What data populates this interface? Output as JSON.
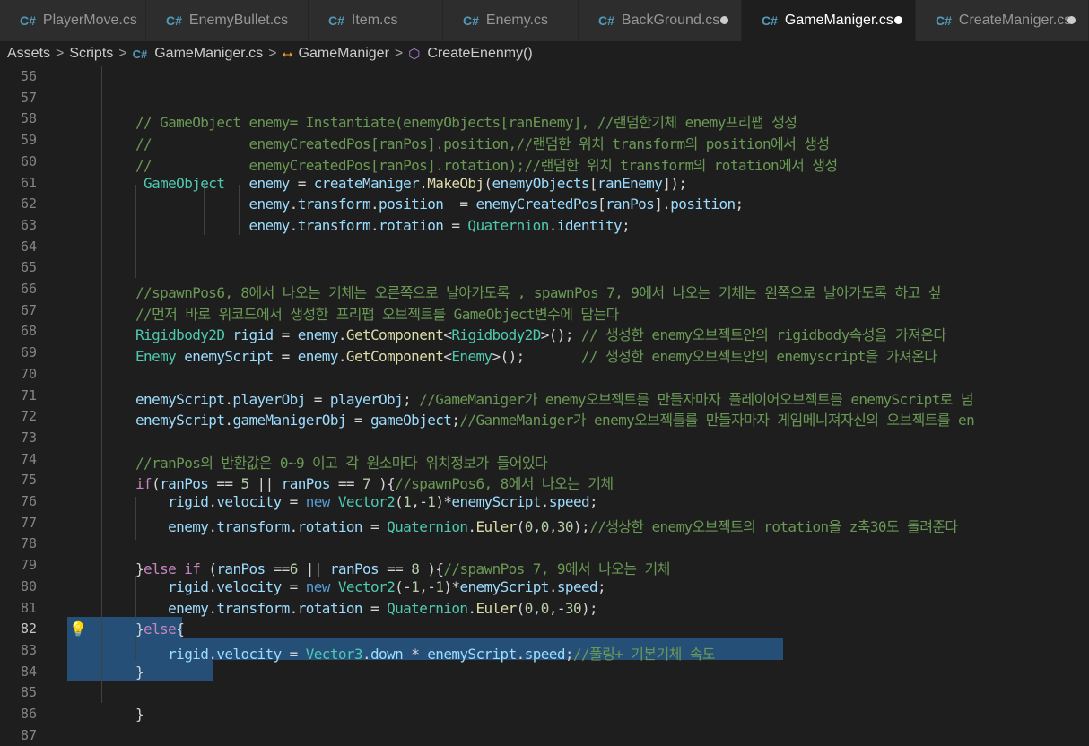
{
  "tabs": [
    {
      "label": "PlayerMove.cs",
      "active": false,
      "dirty": false,
      "width": 163
    },
    {
      "label": "EnemyBullet.cs",
      "active": false,
      "dirty": false,
      "width": 181
    },
    {
      "label": "Item.cs",
      "active": false,
      "dirty": false,
      "width": 150
    },
    {
      "label": "Enemy.cs",
      "active": false,
      "dirty": false,
      "width": 151
    },
    {
      "label": "BackGround.cs",
      "active": false,
      "dirty": true,
      "width": 182
    },
    {
      "label": "GameManiger.cs",
      "active": true,
      "dirty": true,
      "width": 194
    },
    {
      "label": "CreateManiger.cs",
      "active": false,
      "dirty": true,
      "width": 193
    }
  ],
  "breadcrumb": {
    "assets": "Assets",
    "scripts": "Scripts",
    "file": "GameManiger.cs",
    "class": "GameManiger",
    "method": "CreateEnenmy()"
  },
  "icons": {
    "cs": "C#-file-icon",
    "class": "class-icon",
    "method": "method-cube-icon",
    "lightbulb": "lightbulb-icon"
  },
  "colors": {
    "comment": "#6a9955",
    "type": "#4ec9b0",
    "variable": "#9cdcfe",
    "function": "#dcdcaa",
    "keyword": "#569cd6",
    "control": "#c586c0",
    "number": "#b5cea8",
    "selection": "#264f78"
  },
  "code_lines": [
    {
      "n": "56",
      "tokens": []
    },
    {
      "n": "57",
      "tokens": []
    },
    {
      "n": "58",
      "tokens": [
        {
          "t": "// GameObject enemy= Instantiate(enemyObjects[ranEnemy], //랜덤한기체 enemy프리팹 생성",
          "c": "cm"
        }
      ]
    },
    {
      "n": "59",
      "tokens": [
        {
          "t": "//            enemyCreatedPos[ranPos].position,//랜덤한 위치 transform의 position에서 생성",
          "c": "cm"
        }
      ]
    },
    {
      "n": "60",
      "tokens": [
        {
          "t": "//            enemyCreatedPos[ranPos].rotation);//랜덤한 위치 transform의 rotation에서 생성",
          "c": "cm"
        }
      ]
    },
    {
      "n": "61",
      "tokens": [
        {
          "t": " GameObject",
          "c": "ty"
        },
        {
          "t": "   ",
          "c": "pl"
        },
        {
          "t": "enemy",
          "c": "var"
        },
        {
          "t": " = ",
          "c": "pl"
        },
        {
          "t": "createManiger",
          "c": "var"
        },
        {
          "t": ".",
          "c": "pl"
        },
        {
          "t": "MakeObj",
          "c": "fn"
        },
        {
          "t": "(",
          "c": "pl"
        },
        {
          "t": "enemyObjects",
          "c": "var"
        },
        {
          "t": "[",
          "c": "pl"
        },
        {
          "t": "ranEnemy",
          "c": "var"
        },
        {
          "t": "]);",
          "c": "pl"
        }
      ]
    },
    {
      "n": "62",
      "tokens": [
        {
          "t": "              ",
          "c": "pl"
        },
        {
          "t": "enemy",
          "c": "var"
        },
        {
          "t": ".",
          "c": "pl"
        },
        {
          "t": "transform",
          "c": "var"
        },
        {
          "t": ".",
          "c": "pl"
        },
        {
          "t": "position",
          "c": "var"
        },
        {
          "t": "  = ",
          "c": "pl"
        },
        {
          "t": "enemyCreatedPos",
          "c": "var"
        },
        {
          "t": "[",
          "c": "pl"
        },
        {
          "t": "ranPos",
          "c": "var"
        },
        {
          "t": "].",
          "c": "pl"
        },
        {
          "t": "position",
          "c": "var"
        },
        {
          "t": ";",
          "c": "pl"
        }
      ]
    },
    {
      "n": "63",
      "tokens": [
        {
          "t": "              ",
          "c": "pl"
        },
        {
          "t": "enemy",
          "c": "var"
        },
        {
          "t": ".",
          "c": "pl"
        },
        {
          "t": "transform",
          "c": "var"
        },
        {
          "t": ".",
          "c": "pl"
        },
        {
          "t": "rotation",
          "c": "var"
        },
        {
          "t": " = ",
          "c": "pl"
        },
        {
          "t": "Quaternion",
          "c": "ty"
        },
        {
          "t": ".",
          "c": "pl"
        },
        {
          "t": "identity",
          "c": "var"
        },
        {
          "t": ";",
          "c": "pl"
        }
      ]
    },
    {
      "n": "64",
      "tokens": []
    },
    {
      "n": "65",
      "tokens": []
    },
    {
      "n": "66",
      "tokens": [
        {
          "t": "//spawnPos6, 8에서 나오는 기체는 오른쪽으로 날아가도록 , spawnPos 7, 9에서 나오는 기체는 왼쪽으로 날아가도록 하고 싶",
          "c": "cm"
        }
      ]
    },
    {
      "n": "67",
      "tokens": [
        {
          "t": "//먼저 바로 위코드에서 생성한 프리팹 오브젝트를 GameObject변수에 담는다",
          "c": "cm"
        }
      ]
    },
    {
      "n": "68",
      "tokens": [
        {
          "t": "Rigidbody2D",
          "c": "ty"
        },
        {
          "t": " ",
          "c": "pl"
        },
        {
          "t": "rigid",
          "c": "var"
        },
        {
          "t": " = ",
          "c": "pl"
        },
        {
          "t": "enemy",
          "c": "var"
        },
        {
          "t": ".",
          "c": "pl"
        },
        {
          "t": "GetComponent",
          "c": "fn"
        },
        {
          "t": "<",
          "c": "pl"
        },
        {
          "t": "Rigidbody2D",
          "c": "ty"
        },
        {
          "t": ">(); ",
          "c": "pl"
        },
        {
          "t": "// 생성한 enemy오브젝트안의 rigidbody속성을 가져온다",
          "c": "cm"
        }
      ]
    },
    {
      "n": "69",
      "tokens": [
        {
          "t": "Enemy",
          "c": "ty"
        },
        {
          "t": " ",
          "c": "pl"
        },
        {
          "t": "enemyScript",
          "c": "var"
        },
        {
          "t": " = ",
          "c": "pl"
        },
        {
          "t": "enemy",
          "c": "var"
        },
        {
          "t": ".",
          "c": "pl"
        },
        {
          "t": "GetComponent",
          "c": "fn"
        },
        {
          "t": "<",
          "c": "pl"
        },
        {
          "t": "Enemy",
          "c": "ty"
        },
        {
          "t": ">();       ",
          "c": "pl"
        },
        {
          "t": "// 생성한 enemy오브젝트안의 enemyscript을 가져온다",
          "c": "cm"
        }
      ]
    },
    {
      "n": "70",
      "tokens": []
    },
    {
      "n": "71",
      "tokens": [
        {
          "t": "enemyScript",
          "c": "var"
        },
        {
          "t": ".",
          "c": "pl"
        },
        {
          "t": "playerObj",
          "c": "var"
        },
        {
          "t": " = ",
          "c": "pl"
        },
        {
          "t": "playerObj",
          "c": "var"
        },
        {
          "t": "; ",
          "c": "pl"
        },
        {
          "t": "//GameManiger가 enemy오브젝트를 만들자마자 플레이어오브젝트를 enemyScript로 넘",
          "c": "cm"
        }
      ]
    },
    {
      "n": "72",
      "tokens": [
        {
          "t": "enemyScript",
          "c": "var"
        },
        {
          "t": ".",
          "c": "pl"
        },
        {
          "t": "gameManigerObj",
          "c": "var"
        },
        {
          "t": " = ",
          "c": "pl"
        },
        {
          "t": "gameObject",
          "c": "var"
        },
        {
          "t": ";",
          "c": "pl"
        },
        {
          "t": "//GanmeManiger가 enemy오브젝틀를 만들자마자 게임메니져자신의 오브젝트를 en",
          "c": "cm"
        }
      ]
    },
    {
      "n": "73",
      "tokens": []
    },
    {
      "n": "74",
      "tokens": [
        {
          "t": "//ranPos의 반환값은 0~9 이고 각 원소마다 위치정보가 들어있다",
          "c": "cm"
        }
      ]
    },
    {
      "n": "75",
      "tokens": [
        {
          "t": "if",
          "c": "ctl"
        },
        {
          "t": "(",
          "c": "pl"
        },
        {
          "t": "ranPos",
          "c": "var"
        },
        {
          "t": " == ",
          "c": "pl"
        },
        {
          "t": "5",
          "c": "num"
        },
        {
          "t": " || ",
          "c": "pl"
        },
        {
          "t": "ranPos",
          "c": "var"
        },
        {
          "t": " == ",
          "c": "pl"
        },
        {
          "t": "7",
          "c": "num"
        },
        {
          "t": " ){",
          "c": "pl"
        },
        {
          "t": "//spawnPos6, 8에서 나오는 기체",
          "c": "cm"
        }
      ]
    },
    {
      "n": "76",
      "tokens": [
        {
          "t": "    ",
          "c": "pl"
        },
        {
          "t": "rigid",
          "c": "var"
        },
        {
          "t": ".",
          "c": "pl"
        },
        {
          "t": "velocity",
          "c": "var"
        },
        {
          "t": " = ",
          "c": "pl"
        },
        {
          "t": "new",
          "c": "kw"
        },
        {
          "t": " ",
          "c": "pl"
        },
        {
          "t": "Vector2",
          "c": "ty"
        },
        {
          "t": "(",
          "c": "pl"
        },
        {
          "t": "1",
          "c": "num"
        },
        {
          "t": ",-",
          "c": "pl"
        },
        {
          "t": "1",
          "c": "num"
        },
        {
          "t": ")*",
          "c": "pl"
        },
        {
          "t": "enemyScript",
          "c": "var"
        },
        {
          "t": ".",
          "c": "pl"
        },
        {
          "t": "speed",
          "c": "var"
        },
        {
          "t": ";",
          "c": "pl"
        }
      ]
    },
    {
      "n": "77",
      "tokens": [
        {
          "t": "    ",
          "c": "pl"
        },
        {
          "t": "enemy",
          "c": "var"
        },
        {
          "t": ".",
          "c": "pl"
        },
        {
          "t": "transform",
          "c": "var"
        },
        {
          "t": ".",
          "c": "pl"
        },
        {
          "t": "rotation",
          "c": "var"
        },
        {
          "t": " = ",
          "c": "pl"
        },
        {
          "t": "Quaternion",
          "c": "ty"
        },
        {
          "t": ".",
          "c": "pl"
        },
        {
          "t": "Euler",
          "c": "fn"
        },
        {
          "t": "(",
          "c": "pl"
        },
        {
          "t": "0",
          "c": "num"
        },
        {
          "t": ",",
          "c": "pl"
        },
        {
          "t": "0",
          "c": "num"
        },
        {
          "t": ",",
          "c": "pl"
        },
        {
          "t": "30",
          "c": "num"
        },
        {
          "t": ");",
          "c": "pl"
        },
        {
          "t": "//생상한 enemy오브젝트의 rotation을 z축30도 돌려준다",
          "c": "cm"
        }
      ]
    },
    {
      "n": "78",
      "tokens": []
    },
    {
      "n": "79",
      "tokens": [
        {
          "t": "}",
          "c": "pl"
        },
        {
          "t": "else",
          "c": "ctl"
        },
        {
          "t": " ",
          "c": "pl"
        },
        {
          "t": "if",
          "c": "ctl"
        },
        {
          "t": " (",
          "c": "pl"
        },
        {
          "t": "ranPos",
          "c": "var"
        },
        {
          "t": " ==",
          "c": "pl"
        },
        {
          "t": "6",
          "c": "num"
        },
        {
          "t": " || ",
          "c": "pl"
        },
        {
          "t": "ranPos",
          "c": "var"
        },
        {
          "t": " == ",
          "c": "pl"
        },
        {
          "t": "8",
          "c": "num"
        },
        {
          "t": " ){",
          "c": "pl"
        },
        {
          "t": "//spawnPos 7, 9에서 나오는 기체",
          "c": "cm"
        }
      ]
    },
    {
      "n": "80",
      "tokens": [
        {
          "t": "    ",
          "c": "pl"
        },
        {
          "t": "rigid",
          "c": "var"
        },
        {
          "t": ".",
          "c": "pl"
        },
        {
          "t": "velocity",
          "c": "var"
        },
        {
          "t": " = ",
          "c": "pl"
        },
        {
          "t": "new",
          "c": "kw"
        },
        {
          "t": " ",
          "c": "pl"
        },
        {
          "t": "Vector2",
          "c": "ty"
        },
        {
          "t": "(-",
          "c": "pl"
        },
        {
          "t": "1",
          "c": "num"
        },
        {
          "t": ",-",
          "c": "pl"
        },
        {
          "t": "1",
          "c": "num"
        },
        {
          "t": ")*",
          "c": "pl"
        },
        {
          "t": "enemyScript",
          "c": "var"
        },
        {
          "t": ".",
          "c": "pl"
        },
        {
          "t": "speed",
          "c": "var"
        },
        {
          "t": ";",
          "c": "pl"
        }
      ]
    },
    {
      "n": "81",
      "tokens": [
        {
          "t": "    ",
          "c": "pl"
        },
        {
          "t": "enemy",
          "c": "var"
        },
        {
          "t": ".",
          "c": "pl"
        },
        {
          "t": "transform",
          "c": "var"
        },
        {
          "t": ".",
          "c": "pl"
        },
        {
          "t": "rotation",
          "c": "var"
        },
        {
          "t": " = ",
          "c": "pl"
        },
        {
          "t": "Quaternion",
          "c": "ty"
        },
        {
          "t": ".",
          "c": "pl"
        },
        {
          "t": "Euler",
          "c": "fn"
        },
        {
          "t": "(",
          "c": "pl"
        },
        {
          "t": "0",
          "c": "num"
        },
        {
          "t": ",",
          "c": "pl"
        },
        {
          "t": "0",
          "c": "num"
        },
        {
          "t": ",-",
          "c": "pl"
        },
        {
          "t": "30",
          "c": "num"
        },
        {
          "t": ");",
          "c": "pl"
        }
      ]
    },
    {
      "n": "82",
      "tokens": [
        {
          "t": "}",
          "c": "pl"
        },
        {
          "t": "else",
          "c": "ctl"
        },
        {
          "t": "{",
          "c": "pl"
        }
      ]
    },
    {
      "n": "83",
      "tokens": [
        {
          "t": "    ",
          "c": "pl"
        },
        {
          "t": "rigid",
          "c": "var"
        },
        {
          "t": ".",
          "c": "pl"
        },
        {
          "t": "velocity",
          "c": "var"
        },
        {
          "t": " = ",
          "c": "pl"
        },
        {
          "t": "Vector3",
          "c": "ty"
        },
        {
          "t": ".",
          "c": "pl"
        },
        {
          "t": "down",
          "c": "var"
        },
        {
          "t": " * ",
          "c": "pl"
        },
        {
          "t": "enemyScript",
          "c": "var"
        },
        {
          "t": ".",
          "c": "pl"
        },
        {
          "t": "speed",
          "c": "var"
        },
        {
          "t": ";",
          "c": "pl"
        },
        {
          "t": "//풀링+ 기본기체 속도",
          "c": "cm"
        }
      ]
    },
    {
      "n": "84",
      "tokens": [
        {
          "t": "}",
          "c": "pl"
        }
      ]
    },
    {
      "n": "85",
      "tokens": []
    },
    {
      "n": "86",
      "tokens": [
        {
          "t": "}",
          "c": "pl"
        }
      ]
    },
    {
      "n": "87",
      "tokens": []
    }
  ]
}
